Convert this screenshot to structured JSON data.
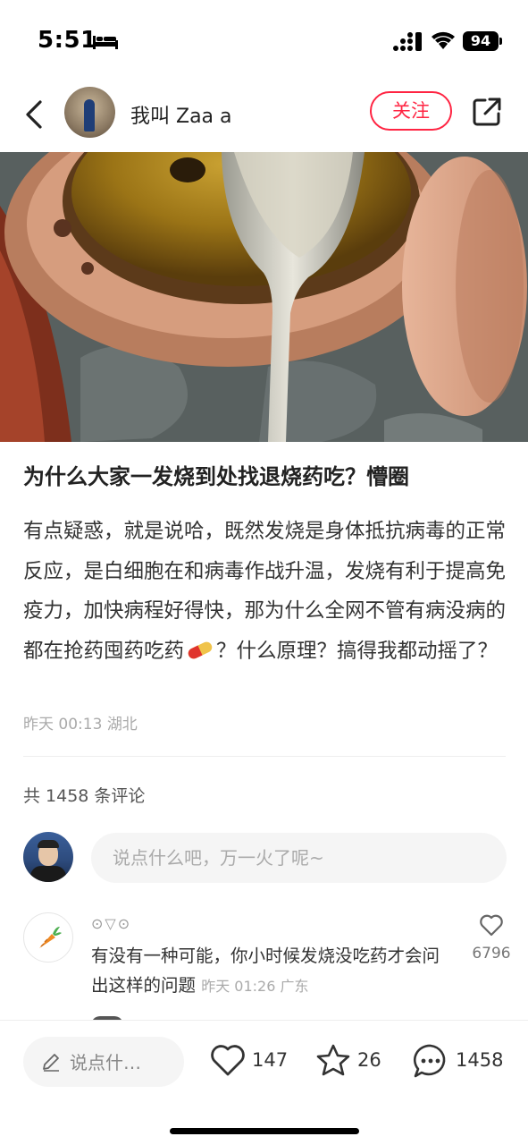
{
  "status_bar": {
    "time": "5:51",
    "battery": "94"
  },
  "header": {
    "author_name": "我叫 Zaa a",
    "follow_label": "关注"
  },
  "post": {
    "title": "为什么大家一发烧到处找退烧药吃？懵圈",
    "body_part1": "有点疑惑，就是说哈，既然发烧是身体抵抗病毒的正常反应，是白细胞在和病毒作战升温，发烧有利于提高免疫力，加快病程好得快，那为什么全网不管有病没病的都在抢药囤药吃药",
    "body_part2": "？什么原理？搞得我都动摇了？",
    "date": "昨天 00:13",
    "location": "湖北"
  },
  "comments_header": "共 1458 条评论",
  "comment_input_placeholder": "说点什么吧，万一火了呢~",
  "comments": [
    {
      "name": "⊙▽⊙",
      "text": "有没有一种可能，你小时候发烧没吃药才会问出这样的问题",
      "meta": "昨天 01:26 广东",
      "likes": "6796"
    }
  ],
  "bottom_bar": {
    "input_label": "说点什…",
    "likes": "147",
    "collects": "26",
    "comments": "1458"
  },
  "colors": {
    "accent": "#ff2442",
    "text": "#222222",
    "muted": "#aaaaaa"
  }
}
